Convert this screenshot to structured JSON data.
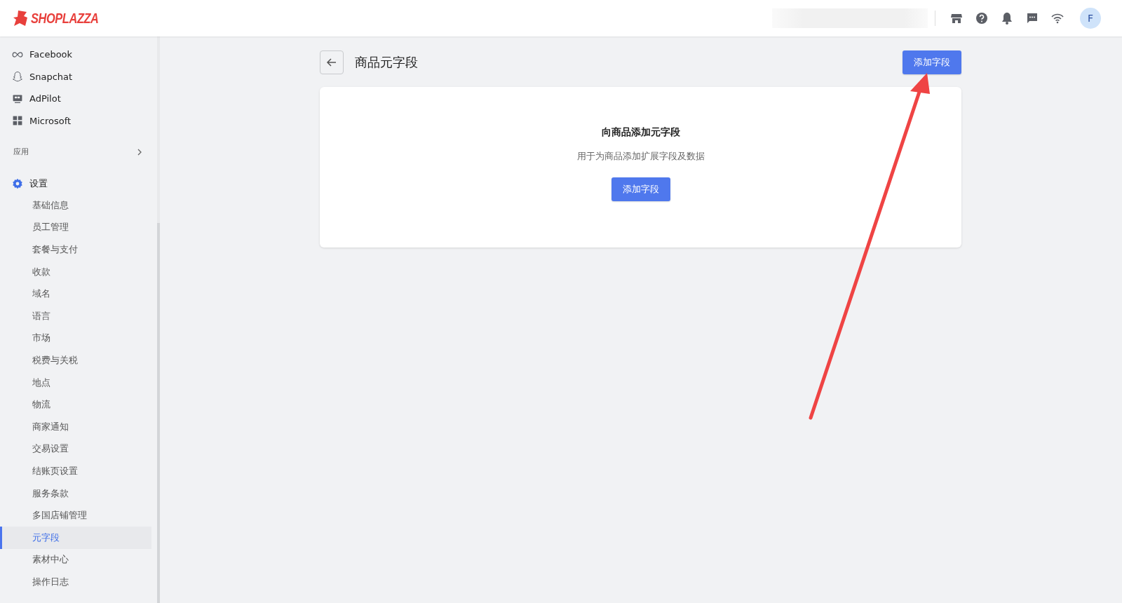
{
  "top_bar": {
    "logo": "SHOPLAZZA",
    "avatar": "F"
  },
  "sidebar": {
    "channels": [
      {
        "label": "Facebook",
        "kind": "infinity"
      },
      {
        "label": "Snapchat",
        "kind": "ghost"
      },
      {
        "label": "AdPilot",
        "kind": "monitor"
      },
      {
        "label": "Microsoft",
        "kind": "grid"
      }
    ],
    "apps_section": "应用",
    "settings": {
      "label": "设置",
      "items": [
        {
          "label": "基础信息",
          "selected": false
        },
        {
          "label": "员工管理",
          "selected": false
        },
        {
          "label": "套餐与支付",
          "selected": false
        },
        {
          "label": "收款",
          "selected": false
        },
        {
          "label": "域名",
          "selected": false
        },
        {
          "label": "语言",
          "selected": false
        },
        {
          "label": "市场",
          "selected": false
        },
        {
          "label": "税费与关税",
          "selected": false
        },
        {
          "label": "地点",
          "selected": false
        },
        {
          "label": "物流",
          "selected": false
        },
        {
          "label": "商家通知",
          "selected": false
        },
        {
          "label": "交易设置",
          "selected": false
        },
        {
          "label": "结账页设置",
          "selected": false
        },
        {
          "label": "服务条款",
          "selected": false
        },
        {
          "label": "多国店铺管理",
          "selected": false
        },
        {
          "label": "元字段",
          "selected": true
        },
        {
          "label": "素材中心",
          "selected": false
        },
        {
          "label": "操作日志",
          "selected": false
        }
      ]
    }
  },
  "page": {
    "title": "商品元字段",
    "header_button": "添加字段",
    "empty_state": {
      "heading": "向商品添加元字段",
      "description": "用于为商品添加扩展字段及数据",
      "button": "添加字段"
    }
  }
}
